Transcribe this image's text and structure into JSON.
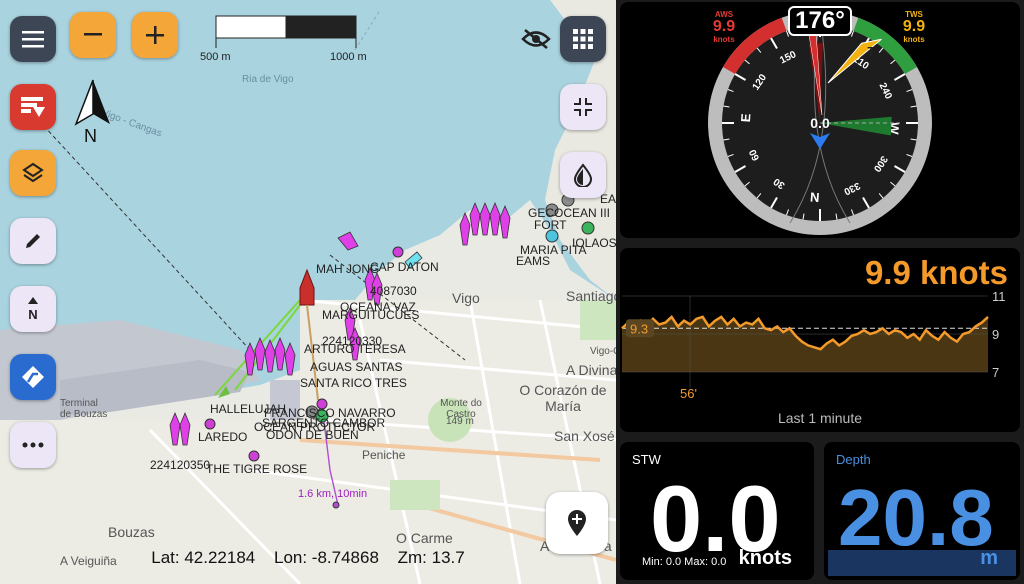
{
  "map": {
    "scale": {
      "left_label": "500 m",
      "right_label": "1000 m"
    },
    "north_label": "N",
    "coords": {
      "lat": "Lat: 42.22184",
      "lon": "Lon: -8.74868",
      "zoom": "Zm: 13.7"
    },
    "labels": {
      "ria_de_vigo": "Ria de Vigo",
      "vigo_cangas": "Vigo - Cangas",
      "vigo": "Vigo",
      "terminal_bouzas": "Terminal de Bouzas",
      "bouzas": "Bouzas",
      "a_veiguina": "A Veiguiña",
      "o_carme": "O Carme",
      "peniche": "Peniche",
      "o_corazon": "O Corazón de María",
      "san_xose": "San Xosé",
      "a_salgueira": "A Salgueira",
      "a_divina": "A Divina",
      "monte_do_castro": "Monte do Castro",
      "santiago": "Santiago",
      "vigo_guixar": "Vigo-Guixar",
      "o_castro_elev": "149 m",
      "laredo": "LAREDO",
      "mah_jong": "MAH JONG",
      "cap_daton": "CAP DATON",
      "oceana_vaz": "OCEANA VAZ",
      "marguitucues": "MARGUITUCUES",
      "arturo_teresa": "ARTURO TERESA",
      "aguas_santas": "AGUAS SANTAS",
      "santa_rico_tres": "SANTA RICO TRES",
      "hallelujah": "HALLELUJAH",
      "francisco_navarro": "FRANCISCO NAVARRO",
      "sargento_cambor": "SARGENTO CAMBOR",
      "ocean_protector": "OCEAN PROTECTOR",
      "odon_de_buen": "ODON DE BUEN",
      "the_tigre_rose": "THE TIGRE ROSE",
      "tiger_ocean_iii": "GECOCEAN III",
      "iolaos": "IOLAOS",
      "fort": "FORT",
      "ea": "EA",
      "maria_pita": "MARIA PITA",
      "eams": "EAMS",
      "mmsi_1": "224120350",
      "mmsi_2": "4087030",
      "mmsi_3": "224120330",
      "route_dist": "1.6 km, 10min",
      "guixar": "Guixar"
    },
    "buttons": {
      "menu": "menu-icon",
      "zoom_out": "minus-icon",
      "zoom_in": "plus-icon"
    }
  },
  "wind": {
    "heading": "176°",
    "aws": {
      "label": "AWS",
      "value": "9.9",
      "unit": "knots",
      "color": "#e53935"
    },
    "tws": {
      "label": "TWS",
      "value": "9.9",
      "unit": "knots",
      "color": "#f2b20f"
    },
    "compass_labels": [
      "N",
      "30",
      "60",
      "E",
      "120",
      "150",
      "210",
      "240",
      "W",
      "300",
      "330"
    ],
    "dial_values": {
      "awa_deg": 5,
      "twa_deg": 31,
      "heading_deg": 176
    },
    "center_value": "0.0",
    "colors": {
      "port": "#d32f2f",
      "starboard": "#2e9e3e"
    }
  },
  "speed_graph": {
    "value": "9.9 knots",
    "avg_label": "9.3",
    "time_label": "56'",
    "caption": "Last 1 minute",
    "y_ticks": [
      "11",
      "9",
      "7"
    ],
    "ylim": [
      7,
      11
    ],
    "series": [
      9.3,
      9.6,
      9.3,
      9.7,
      9.4,
      9.8,
      9.5,
      9.6,
      9.9,
      9.4,
      9.7,
      9.5,
      9.8,
      9.9,
      9.4,
      9.7,
      9.9,
      9.5,
      9.8,
      9.4,
      9.6,
      9.5,
      9.8,
      9.3,
      9.2,
      9.4,
      9.1,
      9.3,
      8.9,
      8.6,
      8.4,
      8.3,
      8.2,
      8.5,
      8.7,
      8.4,
      8.6,
      8.9,
      9.0,
      9.2,
      9.0,
      9.1,
      9.3,
      9.0,
      9.2,
      9.1,
      8.8,
      9.0,
      8.7,
      9.2,
      8.9,
      8.7,
      9.1,
      8.8,
      8.6,
      9.0,
      9.1,
      9.4,
      9.6,
      9.9
    ],
    "color": "#f39a2b"
  },
  "stw": {
    "title": "STW",
    "value": "0.0",
    "min_max": "Min: 0.0 Max: 0.0",
    "unit": "knots"
  },
  "depth": {
    "title": "Depth",
    "value": "20.8",
    "unit": "m",
    "color": "#4a90e2"
  }
}
